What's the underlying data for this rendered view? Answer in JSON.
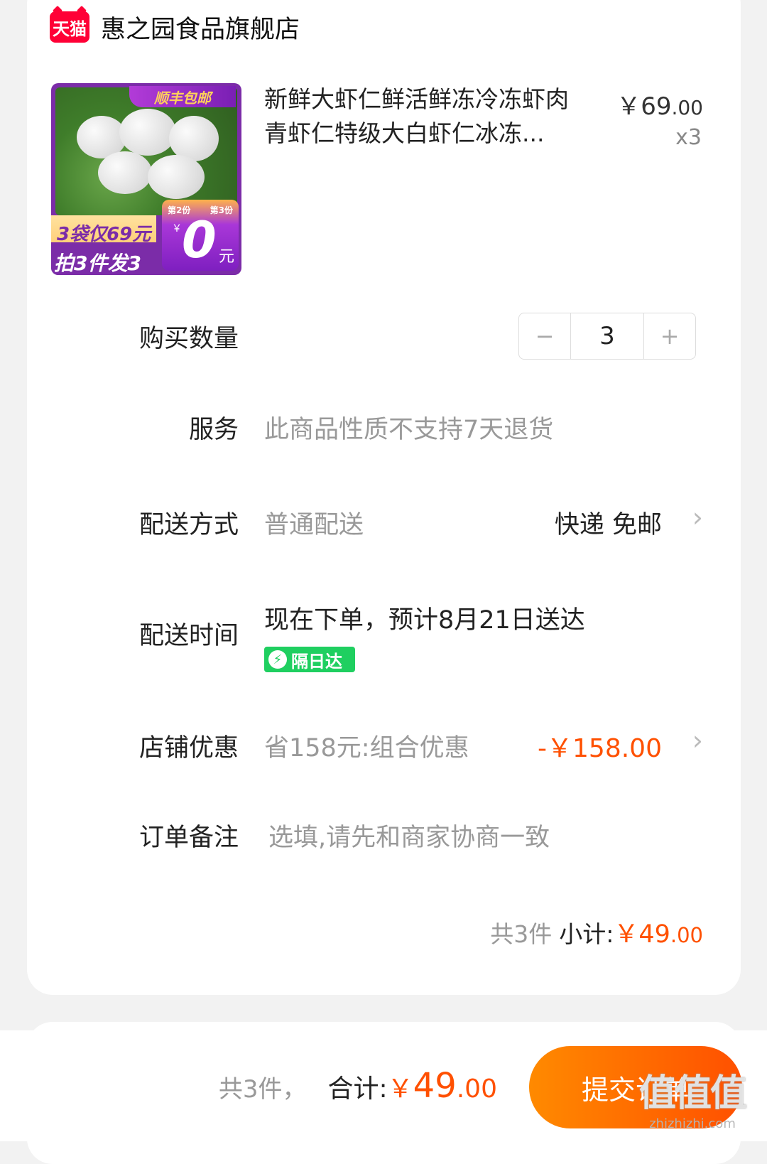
{
  "store": {
    "badge": "天猫",
    "name": "惠之园食品旗舰店"
  },
  "product": {
    "title_line1": "新鲜大虾仁鲜活鲜冻冷冻虾肉",
    "title_line2": "青虾仁特级大白虾仁冰冻...",
    "price": "￥69",
    "price_dec": ".00",
    "qty": "x3",
    "image_promo_top": "顺丰包邮",
    "image_promo_l1": "3袋仅69元",
    "image_promo_l2": "拍3件发3袋",
    "image_tag_2": "第2份",
    "image_tag_3": "第3份",
    "image_yen": "￥",
    "image_zero": "0",
    "image_yuan": "元"
  },
  "rows": {
    "quantity_label": "购买数量",
    "quantity_value": "3",
    "minus": "−",
    "plus": "+",
    "service_label": "服务",
    "service_text": "此商品性质不支持7天退货",
    "delivery_label": "配送方式",
    "delivery_text": "普通配送",
    "delivery_value": "快递 免邮",
    "time_label": "配送时间",
    "time_text": "现在下单，预计8月21日送达",
    "time_badge": "隔日达",
    "discount_label": "店铺优惠",
    "discount_text": "省158元:组合优惠",
    "discount_value": "-￥158.00",
    "note_label": "订单备注",
    "note_placeholder": "选填,请先和商家协商一致"
  },
  "subtotal": {
    "count": "共3件",
    "label": "小计:",
    "amount": "￥49",
    "dec": ".00"
  },
  "bottom": {
    "count": "共3件，",
    "label": "合计:",
    "sym": "￥",
    "amount": "49",
    "dec": ".00",
    "submit": "提交订单"
  },
  "watermark": {
    "text": "值值值",
    "url": "zhizhizhi.com"
  },
  "colors": {
    "accent": "#ff5000",
    "tmall_red": "#ff0036",
    "badge_green": "#1fcf60"
  }
}
